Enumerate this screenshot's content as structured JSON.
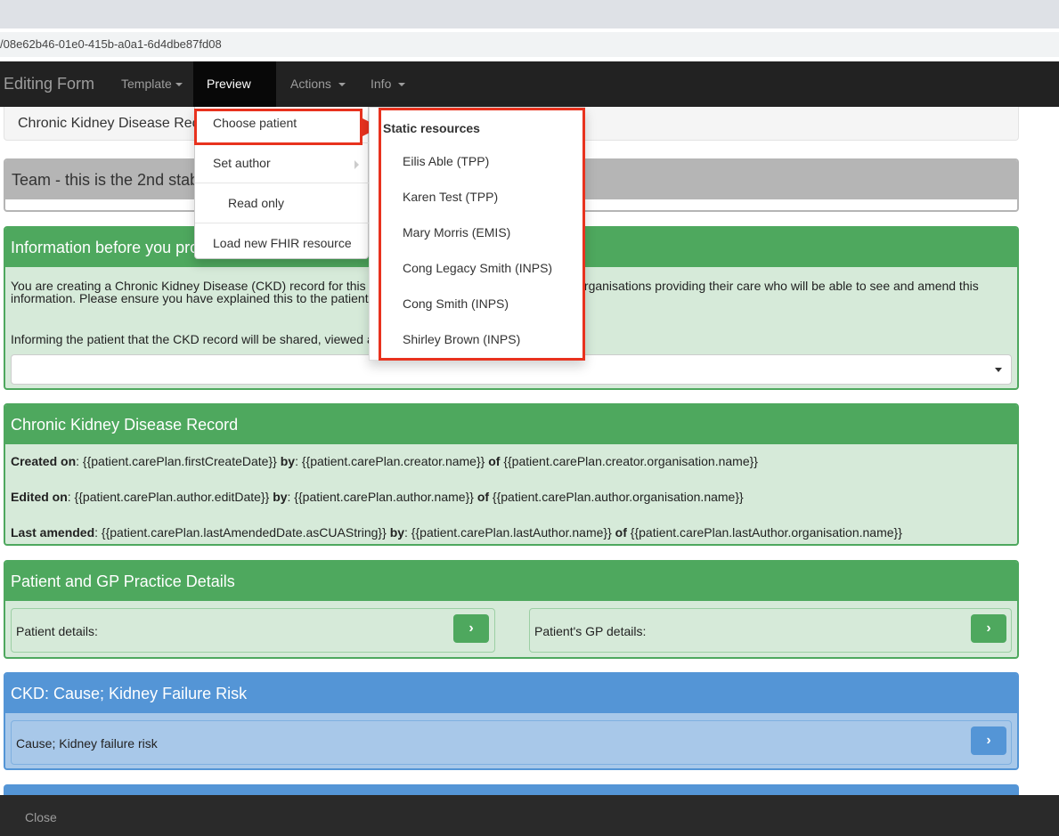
{
  "browser": {
    "url_fragment": "/08e62b46-01e0-415b-a0a1-6d4dbe87fd08"
  },
  "navbar": {
    "brand": "Editing Form",
    "items": [
      {
        "label": "Template"
      },
      {
        "label": "Preview"
      },
      {
        "label": "Actions"
      },
      {
        "label": "Info"
      }
    ]
  },
  "well": {
    "title": "Chronic Kidney Disease Rec"
  },
  "team_panel": {
    "title": "Team - this is the 2nd stab"
  },
  "info_panel": {
    "title": "Information before you pro",
    "line1_start": "You are creating a Chronic Kidney Disease (CKD) record for this",
    "line1_end": "care organisations providing their care who will be able to see and amend this",
    "line2": "information. Please ensure you have explained this to the patient",
    "line3": "Informing the patient that the CKD record will be shared, viewed a"
  },
  "ckd_record": {
    "title": "Chronic Kidney Disease Record",
    "created_label": "Created on",
    "created_value": ": {{patient.carePlan.firstCreateDate}} ",
    "created_by": "by",
    "created_by_value": ": {{patient.carePlan.creator.name}} ",
    "created_of": "of",
    "created_of_value": " {{patient.carePlan.creator.organisation.name}}",
    "edited_label": "Edited on",
    "edited_value": ": {{patient.carePlan.author.editDate}} ",
    "edited_by": "by",
    "edited_by_value": ": {{patient.carePlan.author.name}} ",
    "edited_of": "of",
    "edited_of_value": " {{patient.carePlan.author.organisation.name}}",
    "amended_label": "Last amended",
    "amended_value": ": {{patient.carePlan.lastAmendedDate.asCUAString}} ",
    "amended_by": "by",
    "amended_by_value": ": {{patient.carePlan.lastAuthor.name}} ",
    "amended_of": "of",
    "amended_of_value": " {{patient.carePlan.lastAuthor.organisation.name}}"
  },
  "patient_gp": {
    "title": "Patient and GP Practice Details",
    "patient_label": "Patient details:",
    "gp_label": "Patient's GP details:"
  },
  "ckd_cause": {
    "title": "CKD: Cause; Kidney Failure Risk",
    "item_label": "Cause; Kidney failure risk"
  },
  "preview_menu": {
    "items": [
      "Choose patient",
      "Set author",
      "Read only",
      "Load new FHIR resource"
    ]
  },
  "patient_submenu": {
    "header": "Static resources",
    "patients": [
      "Eilis Able (TPP)",
      "Karen Test (TPP)",
      "Mary Morris (EMIS)",
      "Cong Legacy Smith (INPS)",
      "Cong Smith (INPS)",
      "Shirley Brown (INPS)"
    ]
  },
  "footer": {
    "close_label": "Close"
  },
  "colors": {
    "green": "#4ea85e",
    "blue": "#5495d6",
    "highlight_red": "#e8321e",
    "navbar": "#222222"
  }
}
